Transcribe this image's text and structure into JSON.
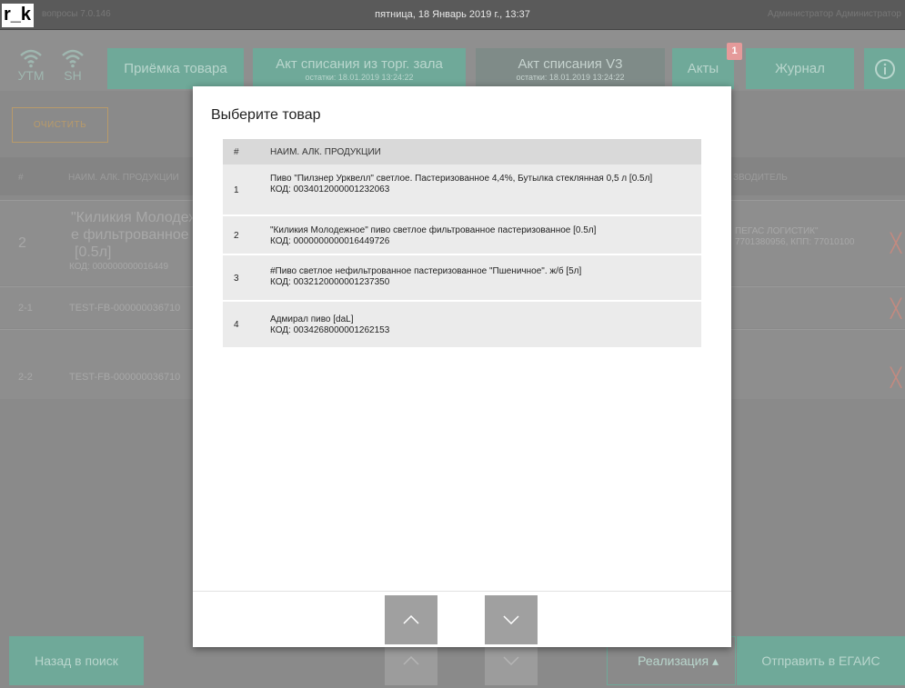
{
  "header": {
    "logo": "r_k",
    "version": "вопросы 7.0.146",
    "datetime": "пятница, 18 Январь 2019 г., 13:37",
    "user": "Администратор Администратор"
  },
  "nav": {
    "utm_label": "УТМ",
    "sh_label": "SH",
    "receive_label": "Приёмка товара",
    "act_trade_title": "Акт списания из торг. зала",
    "act_trade_sub": "остатки: 18.01.2019 13:24:22",
    "act_v3_title": "Акт списания V3",
    "act_v3_sub": "остатки: 18.01.2019 13:24:22",
    "acts_label": "Акты",
    "acts_badge": "1",
    "journal_label": "Журнал"
  },
  "page": {
    "clear_label": "ОЧИСТИТЬ",
    "col_num": "#",
    "col_name": "НАИМ. АЛК. ПРОДУКЦИИ",
    "col_producer": "ЗВОДИТЕЛЬ",
    "row1_num": "2",
    "row1_name_l1": "\"Киликия Молодеж",
    "row1_name_l2": "е фильтрованное",
    "row1_name_l3": "[0.5л]",
    "row1_code": "КОД: 000000000016449",
    "row1_prod_l1": "ПЕГАС ЛОГИСТИК\"",
    "row1_prod_l2": "7701380956, КПП: 77010100",
    "row2_num": "2-1",
    "row2_name": "TEST-FB-000000036710",
    "row3_num": "2-2",
    "row3_name": "TEST-FB-000000036710",
    "delete_glyph": "╳"
  },
  "bottom": {
    "back_label": "Назад в поиск",
    "sale_label": "Реализация ▴",
    "send_label": "Отправить в ЕГАИС"
  },
  "modal": {
    "title": "Выберите товар",
    "col_num": "#",
    "col_name": "НАИМ. АЛК. ПРОДУКЦИИ",
    "items": [
      {
        "num": "1",
        "name": "Пиво \"Пилзнер Урквелл\" светлое. Пастеризованное 4,4%, Бутылка стеклянная 0,5 л  [0.5л]",
        "code": "КОД: 0034012000001232063"
      },
      {
        "num": "2",
        "name": "\"Киликия Молодежное\" пиво светлое фильтрованное пастеризованное  [0.5л]",
        "code": "КОД: 0000000000016449726"
      },
      {
        "num": "3",
        "name": "#Пиво светлое нефильтрованное пастеризованное \"Пшеничное\". ж/б  [5л]",
        "code": "КОД: 0032120000001237350"
      },
      {
        "num": "4",
        "name": "Адмирал пиво  [daL]",
        "code": "КОД: 0034268000001262153"
      }
    ]
  },
  "colors": {
    "accent_green": "#6fa999",
    "delete_red": "#c38a80",
    "topbar": "#5a5a5a"
  }
}
